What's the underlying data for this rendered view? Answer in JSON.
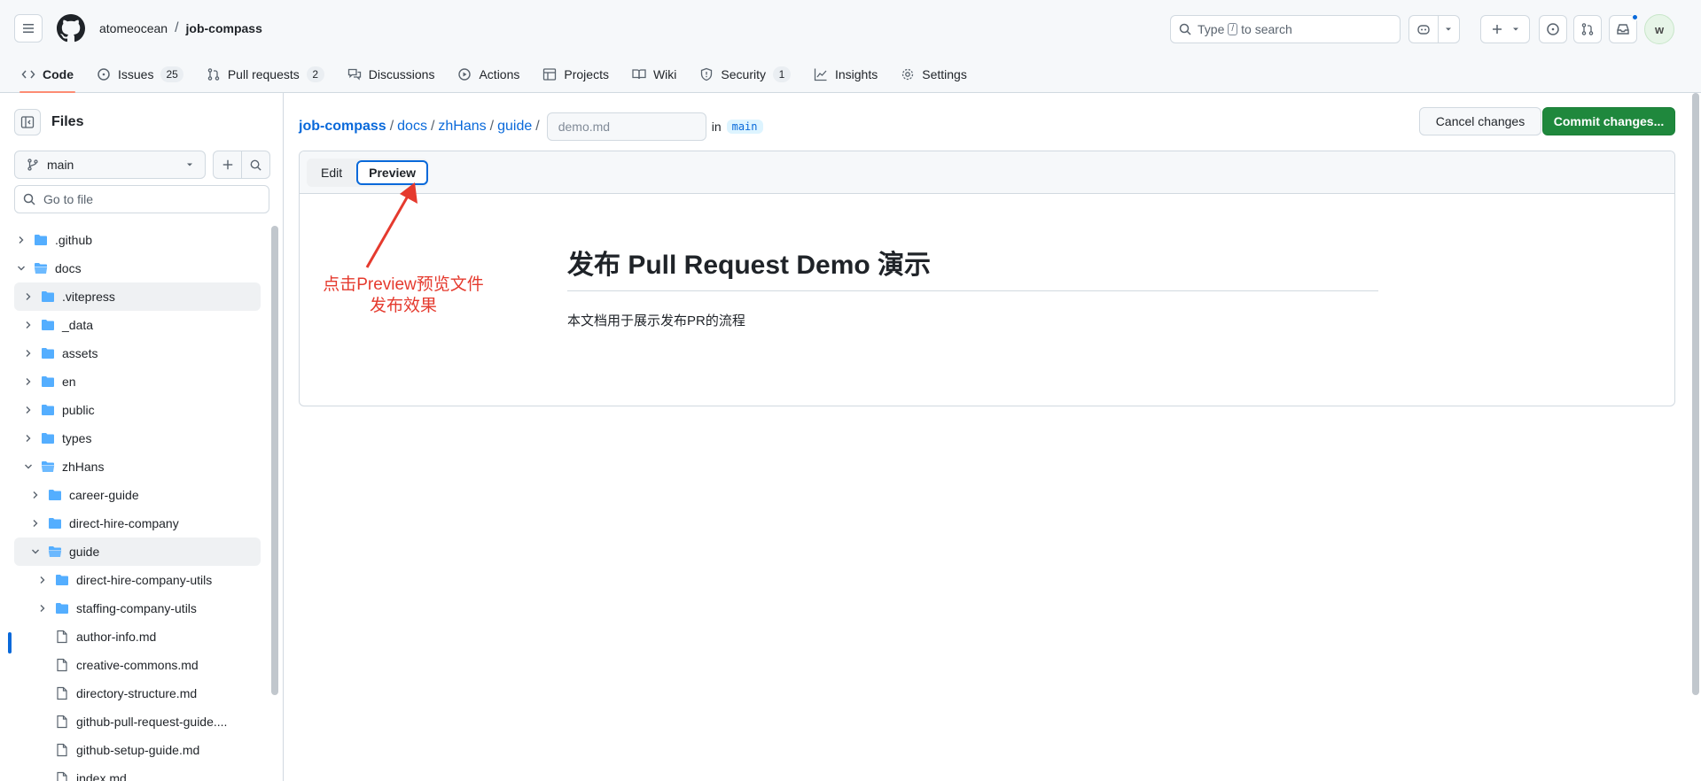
{
  "header": {
    "owner": "atomeocean",
    "repo": "job-compass",
    "search_before": "Type",
    "search_key": "/",
    "search_after": "to search",
    "avatar_letter": "w"
  },
  "nav": {
    "code": "Code",
    "issues": "Issues",
    "issues_count": "25",
    "pull_requests": "Pull requests",
    "pr_count": "2",
    "discussions": "Discussions",
    "actions": "Actions",
    "projects": "Projects",
    "wiki": "Wiki",
    "security": "Security",
    "security_count": "1",
    "insights": "Insights",
    "settings": "Settings"
  },
  "sidebar": {
    "title": "Files",
    "branch": "main",
    "goto_placeholder": "Go to file",
    "tree": [
      {
        "label": ".github",
        "type": "folder",
        "depth": 0,
        "open": false
      },
      {
        "label": "docs",
        "type": "folder",
        "depth": 0,
        "open": true
      },
      {
        "label": ".vitepress",
        "type": "folder",
        "depth": 1,
        "open": false
      },
      {
        "label": "_data",
        "type": "folder",
        "depth": 1,
        "open": false
      },
      {
        "label": "assets",
        "type": "folder",
        "depth": 1,
        "open": false
      },
      {
        "label": "en",
        "type": "folder",
        "depth": 1,
        "open": false
      },
      {
        "label": "public",
        "type": "folder",
        "depth": 1,
        "open": false
      },
      {
        "label": "types",
        "type": "folder",
        "depth": 1,
        "open": false
      },
      {
        "label": "zhHans",
        "type": "folder",
        "depth": 1,
        "open": true
      },
      {
        "label": "career-guide",
        "type": "folder",
        "depth": 2,
        "open": false
      },
      {
        "label": "direct-hire-company",
        "type": "folder",
        "depth": 2,
        "open": false
      },
      {
        "label": "guide",
        "type": "folder",
        "depth": 2,
        "open": true
      },
      {
        "label": "direct-hire-company-utils",
        "type": "folder",
        "depth": 3,
        "open": false
      },
      {
        "label": "staffing-company-utils",
        "type": "folder",
        "depth": 3,
        "open": false
      },
      {
        "label": "author-info.md",
        "type": "file",
        "depth": 3
      },
      {
        "label": "creative-commons.md",
        "type": "file",
        "depth": 3
      },
      {
        "label": "directory-structure.md",
        "type": "file",
        "depth": 3
      },
      {
        "label": "github-pull-request-guide....",
        "type": "file",
        "depth": 3
      },
      {
        "label": "github-setup-guide.md",
        "type": "file",
        "depth": 3
      },
      {
        "label": "index.md",
        "type": "file",
        "depth": 3
      }
    ]
  },
  "breadcrumb": {
    "root": "job-compass",
    "p1": "docs",
    "p2": "zhHans",
    "p3": "guide",
    "sep": "/",
    "filename_placeholder": "demo.md",
    "in_label": "in",
    "branch": "main"
  },
  "actions": {
    "cancel": "Cancel changes",
    "commit": "Commit changes..."
  },
  "editor": {
    "tab_edit": "Edit",
    "tab_preview": "Preview",
    "preview_heading": "发布 Pull Request Demo 演示",
    "preview_paragraph": "本文档用于展示发布PR的流程"
  },
  "annotation": {
    "line1": "点击Preview预览文件",
    "line2": "发布效果",
    "color": "#e53a2e"
  }
}
